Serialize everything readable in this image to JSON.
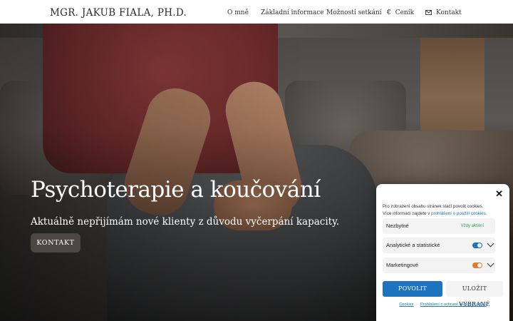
{
  "header": {
    "brand": "MGR. JAKUB FIALA, PH.D.",
    "nav": {
      "o_mne": "O mně",
      "zakladni": "Základní informace",
      "moznosti": "Možnosti setkání",
      "cenik_icon": "€",
      "cenik": "Ceník",
      "kontakt": "Kontakt"
    }
  },
  "hero": {
    "title": "Psychoterapie a koučování",
    "subtitle": "Aktuálně nepřijímám nové klienty z důvodu vyčerpání kapacity.",
    "button": "KONTAKT"
  },
  "cookie": {
    "close": "✕",
    "text_line1": "Pro zobrazení obsahu stránek stačí povolit cookies.",
    "text_line2_prefix": "Více informací najdete v ",
    "text_link": "prohlášení o použití cookies",
    "text_line2_suffix": ".",
    "categories": [
      {
        "label": "Nezbytné",
        "status": "Vždy aktivní"
      },
      {
        "label": "Analytické a statistické",
        "toggle_color": "#1e73be"
      },
      {
        "label": "Marketingové",
        "toggle_color": "#e8772e"
      }
    ],
    "accept_all": "POVOLIT VŠECHNY",
    "save_selected": "ULOŽIT VYBRANÉ",
    "links": [
      "Cookies",
      "Prohlášení o ochraně osobních údajů"
    ]
  },
  "colors": {
    "accent": "#1e73be",
    "status_active": "#2e9e43",
    "marketing_toggle": "#e8772e"
  }
}
